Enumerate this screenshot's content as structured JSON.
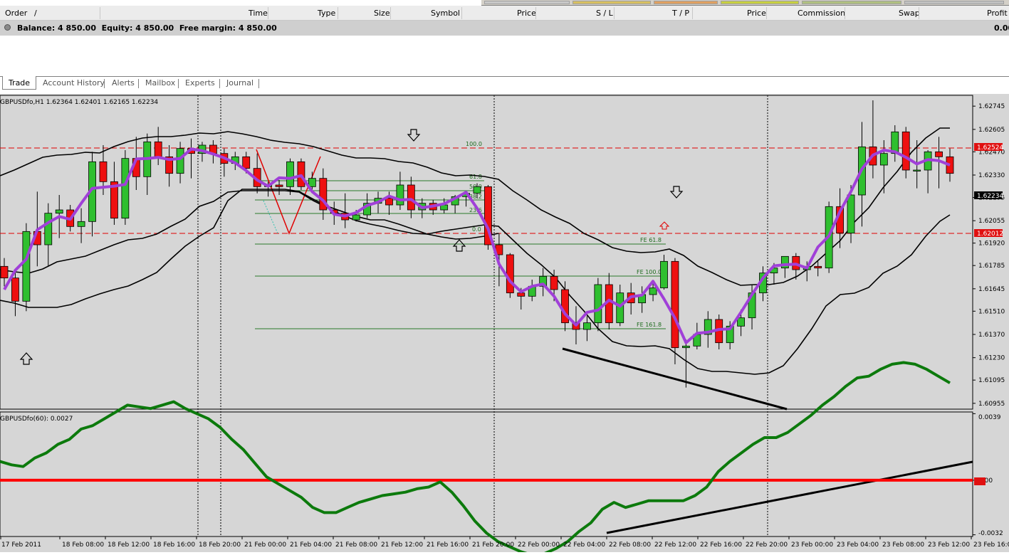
{
  "terminal": {
    "columns": [
      "Order",
      "/",
      "Time",
      "Type",
      "Size",
      "Symbol",
      "Price",
      "S / L",
      "T / P",
      "Price",
      "Commission",
      "Swap",
      "Profit"
    ],
    "balance_text": "Balance: 4 850.00  Equity: 4 850.00  Free margin: 4 850.00",
    "profit_total": "0.00",
    "tabs": [
      "Trade",
      "Account History",
      "Alerts",
      "Mailbox",
      "Experts",
      "Journal"
    ],
    "active_tab": "Trade"
  },
  "chart_data": [
    {
      "type": "candlestick",
      "title": "GBPUSDfo,H1  1.62364 1.62401 1.62165 1.62234",
      "y_ticks": [
        "1.62745",
        "1.62605",
        "1.62470",
        "1.62330",
        "1.62195",
        "1.62055",
        "1.61920",
        "1.61785",
        "1.61645",
        "1.61510",
        "1.61370",
        "1.61230",
        "1.61095",
        "1.60955"
      ],
      "ylim": [
        1.6092,
        1.6281
      ],
      "current_price_label": "1.62234",
      "red_levels": [
        "1.62524",
        "1.62012"
      ],
      "level_values": [
        1.62524,
        1.62012
      ],
      "fib_labels": [
        "100.0",
        "61.8",
        "50.0",
        "38.2",
        "23.6",
        "0.0"
      ],
      "fib_expansion_labels": [
        "FE 61.8",
        "FE 100.0",
        "FE 161.8"
      ],
      "x_ticks": [
        "17 Feb 2011",
        "18 Feb 08:00",
        "18 Feb 12:00",
        "18 Feb 16:00",
        "18 Feb 20:00",
        "21 Feb 00:00",
        "21 Feb 04:00",
        "21 Feb 08:00",
        "21 Feb 12:00",
        "21 Feb 16:00",
        "21 Feb 20:00",
        "22 Feb 00:00",
        "22 Feb 04:00",
        "22 Feb 08:00",
        "22 Feb 12:00",
        "22 Feb 16:00",
        "22 Feb 20:00",
        "23 Feb 00:00",
        "23 Feb 04:00",
        "23 Feb 08:00",
        "23 Feb 12:00",
        "23 Feb 16:00"
      ],
      "candles": [
        [
          1.6178,
          1.6183,
          1.6166,
          1.6171
        ],
        [
          1.6171,
          1.6176,
          1.6148,
          1.6157
        ],
        [
          1.6157,
          1.6204,
          1.6151,
          1.6199
        ],
        [
          1.6199,
          1.6223,
          1.6178,
          1.6191
        ],
        [
          1.6191,
          1.6216,
          1.6178,
          1.621
        ],
        [
          1.621,
          1.6221,
          1.6195,
          1.6212
        ],
        [
          1.6212,
          1.6215,
          1.6199,
          1.6202
        ],
        [
          1.6202,
          1.6213,
          1.6192,
          1.6205
        ],
        [
          1.6205,
          1.6247,
          1.6196,
          1.6241
        ],
        [
          1.6241,
          1.6251,
          1.6221,
          1.6229
        ],
        [
          1.6229,
          1.6241,
          1.6203,
          1.6207
        ],
        [
          1.6207,
          1.6248,
          1.6203,
          1.6243
        ],
        [
          1.6243,
          1.6256,
          1.6224,
          1.6232
        ],
        [
          1.6232,
          1.6258,
          1.6221,
          1.6253
        ],
        [
          1.6253,
          1.6262,
          1.6239,
          1.6244
        ],
        [
          1.6244,
          1.6251,
          1.6226,
          1.6234
        ],
        [
          1.6234,
          1.6253,
          1.6228,
          1.6249
        ],
        [
          1.6249,
          1.6255,
          1.6231,
          1.6246
        ],
        [
          1.6246,
          1.6253,
          1.6241,
          1.6251
        ],
        [
          1.6251,
          1.6254,
          1.624,
          1.6246
        ],
        [
          1.6246,
          1.6249,
          1.6232,
          1.624
        ],
        [
          1.624,
          1.6247,
          1.6236,
          1.6244
        ],
        [
          1.6244,
          1.6247,
          1.6234,
          1.6237
        ],
        [
          1.6237,
          1.6246,
          1.6222,
          1.6226
        ],
        [
          1.6226,
          1.6229,
          1.622,
          1.6227
        ],
        [
          1.6227,
          1.623,
          1.6221,
          1.6226
        ],
        [
          1.6226,
          1.6243,
          1.6221,
          1.6241
        ],
        [
          1.6241,
          1.6243,
          1.6224,
          1.6226
        ],
        [
          1.6226,
          1.6235,
          1.6222,
          1.6231
        ],
        [
          1.6231,
          1.6237,
          1.6206,
          1.6212
        ],
        [
          1.6212,
          1.6217,
          1.6203,
          1.621
        ],
        [
          1.621,
          1.6222,
          1.6201,
          1.6206
        ],
        [
          1.6206,
          1.6212,
          1.6205,
          1.6209
        ],
        [
          1.6209,
          1.6222,
          1.6207,
          1.6216
        ],
        [
          1.6216,
          1.6223,
          1.621,
          1.6219
        ],
        [
          1.6219,
          1.6223,
          1.6209,
          1.6215
        ],
        [
          1.6215,
          1.6235,
          1.6212,
          1.6227
        ],
        [
          1.6227,
          1.6232,
          1.6207,
          1.6212
        ],
        [
          1.6212,
          1.6219,
          1.6207,
          1.6216
        ],
        [
          1.6216,
          1.6218,
          1.6209,
          1.6212
        ],
        [
          1.6212,
          1.6219,
          1.621,
          1.6215
        ],
        [
          1.6215,
          1.6221,
          1.621,
          1.622
        ],
        [
          1.622,
          1.6223,
          1.6214,
          1.6222
        ],
        [
          1.6222,
          1.6228,
          1.6219,
          1.6226
        ],
        [
          1.6226,
          1.6227,
          1.6188,
          1.6191
        ],
        [
          1.6191,
          1.6198,
          1.6166,
          1.6185
        ],
        [
          1.6185,
          1.6186,
          1.6159,
          1.6162
        ],
        [
          1.6162,
          1.6165,
          1.6152,
          1.616
        ],
        [
          1.616,
          1.617,
          1.6157,
          1.6166
        ],
        [
          1.6166,
          1.6177,
          1.616,
          1.6172
        ],
        [
          1.6172,
          1.6176,
          1.6157,
          1.6164
        ],
        [
          1.6164,
          1.6169,
          1.6139,
          1.6144
        ],
        [
          1.6144,
          1.6154,
          1.6131,
          1.614
        ],
        [
          1.614,
          1.6148,
          1.6133,
          1.6144
        ],
        [
          1.6144,
          1.6171,
          1.6139,
          1.6167
        ],
        [
          1.6167,
          1.6174,
          1.614,
          1.6144
        ],
        [
          1.6144,
          1.6167,
          1.6142,
          1.6162
        ],
        [
          1.6162,
          1.6168,
          1.6149,
          1.6156
        ],
        [
          1.6156,
          1.6166,
          1.615,
          1.6161
        ],
        [
          1.6161,
          1.6169,
          1.6157,
          1.6165
        ],
        [
          1.6165,
          1.6185,
          1.6164,
          1.6181
        ],
        [
          1.6181,
          1.6183,
          1.6119,
          1.6129
        ],
        [
          1.6129,
          1.6134,
          1.6105,
          1.613
        ],
        [
          1.613,
          1.6144,
          1.6128,
          1.6137
        ],
        [
          1.6137,
          1.6151,
          1.6129,
          1.6146
        ],
        [
          1.6146,
          1.6149,
          1.6128,
          1.6132
        ],
        [
          1.6132,
          1.6145,
          1.6128,
          1.6142
        ],
        [
          1.6142,
          1.6152,
          1.6136,
          1.6147
        ],
        [
          1.6147,
          1.6167,
          1.614,
          1.6162
        ],
        [
          1.6162,
          1.6178,
          1.6157,
          1.6174
        ],
        [
          1.6174,
          1.618,
          1.6167,
          1.6177
        ],
        [
          1.6177,
          1.6184,
          1.6171,
          1.6184
        ],
        [
          1.6184,
          1.6186,
          1.617,
          1.6176
        ],
        [
          1.6176,
          1.6181,
          1.6169,
          1.6178
        ],
        [
          1.6178,
          1.6181,
          1.6172,
          1.6177
        ],
        [
          1.6177,
          1.6217,
          1.6174,
          1.6214
        ],
        [
          1.6214,
          1.6225,
          1.6189,
          1.6198
        ],
        [
          1.6198,
          1.6227,
          1.6192,
          1.6221
        ],
        [
          1.6221,
          1.6265,
          1.6202,
          1.625
        ],
        [
          1.625,
          1.6278,
          1.6231,
          1.6239
        ],
        [
          1.6239,
          1.6254,
          1.6222,
          1.6246
        ],
        [
          1.6246,
          1.6263,
          1.6241,
          1.6259
        ],
        [
          1.6259,
          1.6262,
          1.6231,
          1.6236
        ],
        [
          1.6236,
          1.6254,
          1.6225,
          1.6236
        ],
        [
          1.6236,
          1.6248,
          1.6222,
          1.6247
        ],
        [
          1.6247,
          1.6256,
          1.6225,
          1.6244
        ],
        [
          1.6244,
          1.6249,
          1.6229,
          1.6234
        ]
      ]
    },
    {
      "type": "line",
      "title": "GBPUSDfo(60):  0.0027",
      "y_ticks": [
        "0.0039",
        "0.00",
        "-0.0032"
      ],
      "ylim": [
        -0.0033,
        0.004
      ],
      "zero_label": "0.00",
      "series": [
        {
          "values": [
            0.0011,
            0.0009,
            0.0008,
            0.0013,
            0.0016,
            0.0021,
            0.0024,
            0.003,
            0.0032,
            0.0036,
            0.004,
            0.0044,
            0.0043,
            0.0042,
            0.0044,
            0.0046,
            0.0042,
            0.0039,
            0.0036,
            0.0031,
            0.0024,
            0.0018,
            0.001,
            0.0002,
            -0.0002,
            -0.0006,
            -0.001,
            -0.0016,
            -0.0019,
            -0.0019,
            -0.0016,
            -0.0013,
            -0.0011,
            -0.0009,
            -0.0008,
            -0.0007,
            -0.0005,
            -0.0004,
            -0.0001,
            -0.0007,
            -0.0015,
            -0.0024,
            -0.0031,
            -0.0036,
            -0.0039,
            -0.0042,
            -0.0044,
            -0.0043,
            -0.004,
            -0.0036,
            -0.003,
            -0.0025,
            -0.0017,
            -0.0013,
            -0.0016,
            -0.0014,
            -0.0012,
            -0.0012,
            -0.0012,
            -0.0012,
            -0.0009,
            -0.0004,
            0.0005,
            0.0011,
            0.0016,
            0.0021,
            0.0025,
            0.0025,
            0.0028,
            0.0033,
            0.0038,
            0.0044,
            0.0049,
            0.0055,
            0.006,
            0.0061,
            0.0065,
            0.0068,
            0.0069,
            0.0068,
            0.0065,
            0.0061,
            0.0057
          ]
        }
      ],
      "trendline": "black line 22 Feb 06:00 to 23 Feb 16:00"
    }
  ]
}
